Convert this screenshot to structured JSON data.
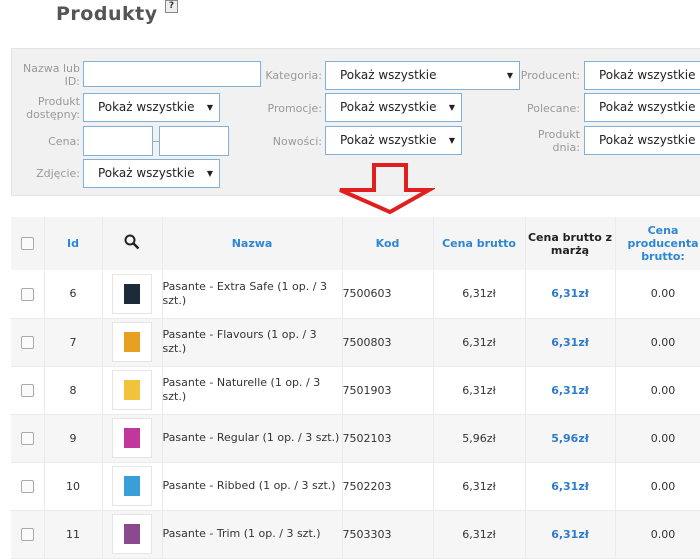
{
  "page": {
    "title": "Produkty",
    "help": "?"
  },
  "filters": {
    "name_label": "Nazwa lub ID:",
    "available_label": "Produkt dostępny:",
    "price_label": "Cena:",
    "photo_label": "Zdjęcie:",
    "category_label": "Kategoria:",
    "promo_label": "Promocje:",
    "news_label": "Nowości:",
    "producer_label": "Producent:",
    "recommended_label": "Polecane:",
    "dayproduct_label": "Produkt dnia:",
    "show_all": "Pokaż wszystkie"
  },
  "table": {
    "headers": {
      "id": "Id",
      "name": "Nazwa",
      "code": "Kod",
      "price_gross": "Cena brutto",
      "price_margin": "Cena brutto z marżą",
      "producer_price": "Cena producenta brutto:"
    },
    "rows": [
      {
        "id": "6",
        "name": "Pasante - Extra Safe (1 op. / 3 szt.)",
        "code": "7500603",
        "price": "6,31zł",
        "price_margin": "6,31zł",
        "producer_price": "0.00",
        "thumb_color": "#1d2a3a"
      },
      {
        "id": "7",
        "name": "Pasante - Flavours (1 op. / 3 szt.)",
        "code": "7500803",
        "price": "6,31zł",
        "price_margin": "6,31zł",
        "producer_price": "0.00",
        "thumb_color": "#e8a020"
      },
      {
        "id": "8",
        "name": "Pasante - Naturelle (1 op. / 3 szt.)",
        "code": "7501903",
        "price": "6,31zł",
        "price_margin": "6,31zł",
        "producer_price": "0.00",
        "thumb_color": "#f0c33a"
      },
      {
        "id": "9",
        "name": "Pasante - Regular (1 op. / 3 szt.)",
        "code": "7502103",
        "price": "5,96zł",
        "price_margin": "5,96zł",
        "producer_price": "0.00",
        "thumb_color": "#c0399a"
      },
      {
        "id": "10",
        "name": "Pasante - Ribbed (1 op. / 3 szt.)",
        "code": "7502203",
        "price": "6,31zł",
        "price_margin": "6,31zł",
        "producer_price": "0.00",
        "thumb_color": "#3a9ed8"
      },
      {
        "id": "11",
        "name": "Pasante - Trim (1 op. / 3 szt.)",
        "code": "7503303",
        "price": "6,31zł",
        "price_margin": "6,31zł",
        "producer_price": "0.00",
        "thumb_color": "#8a4a90"
      }
    ]
  }
}
